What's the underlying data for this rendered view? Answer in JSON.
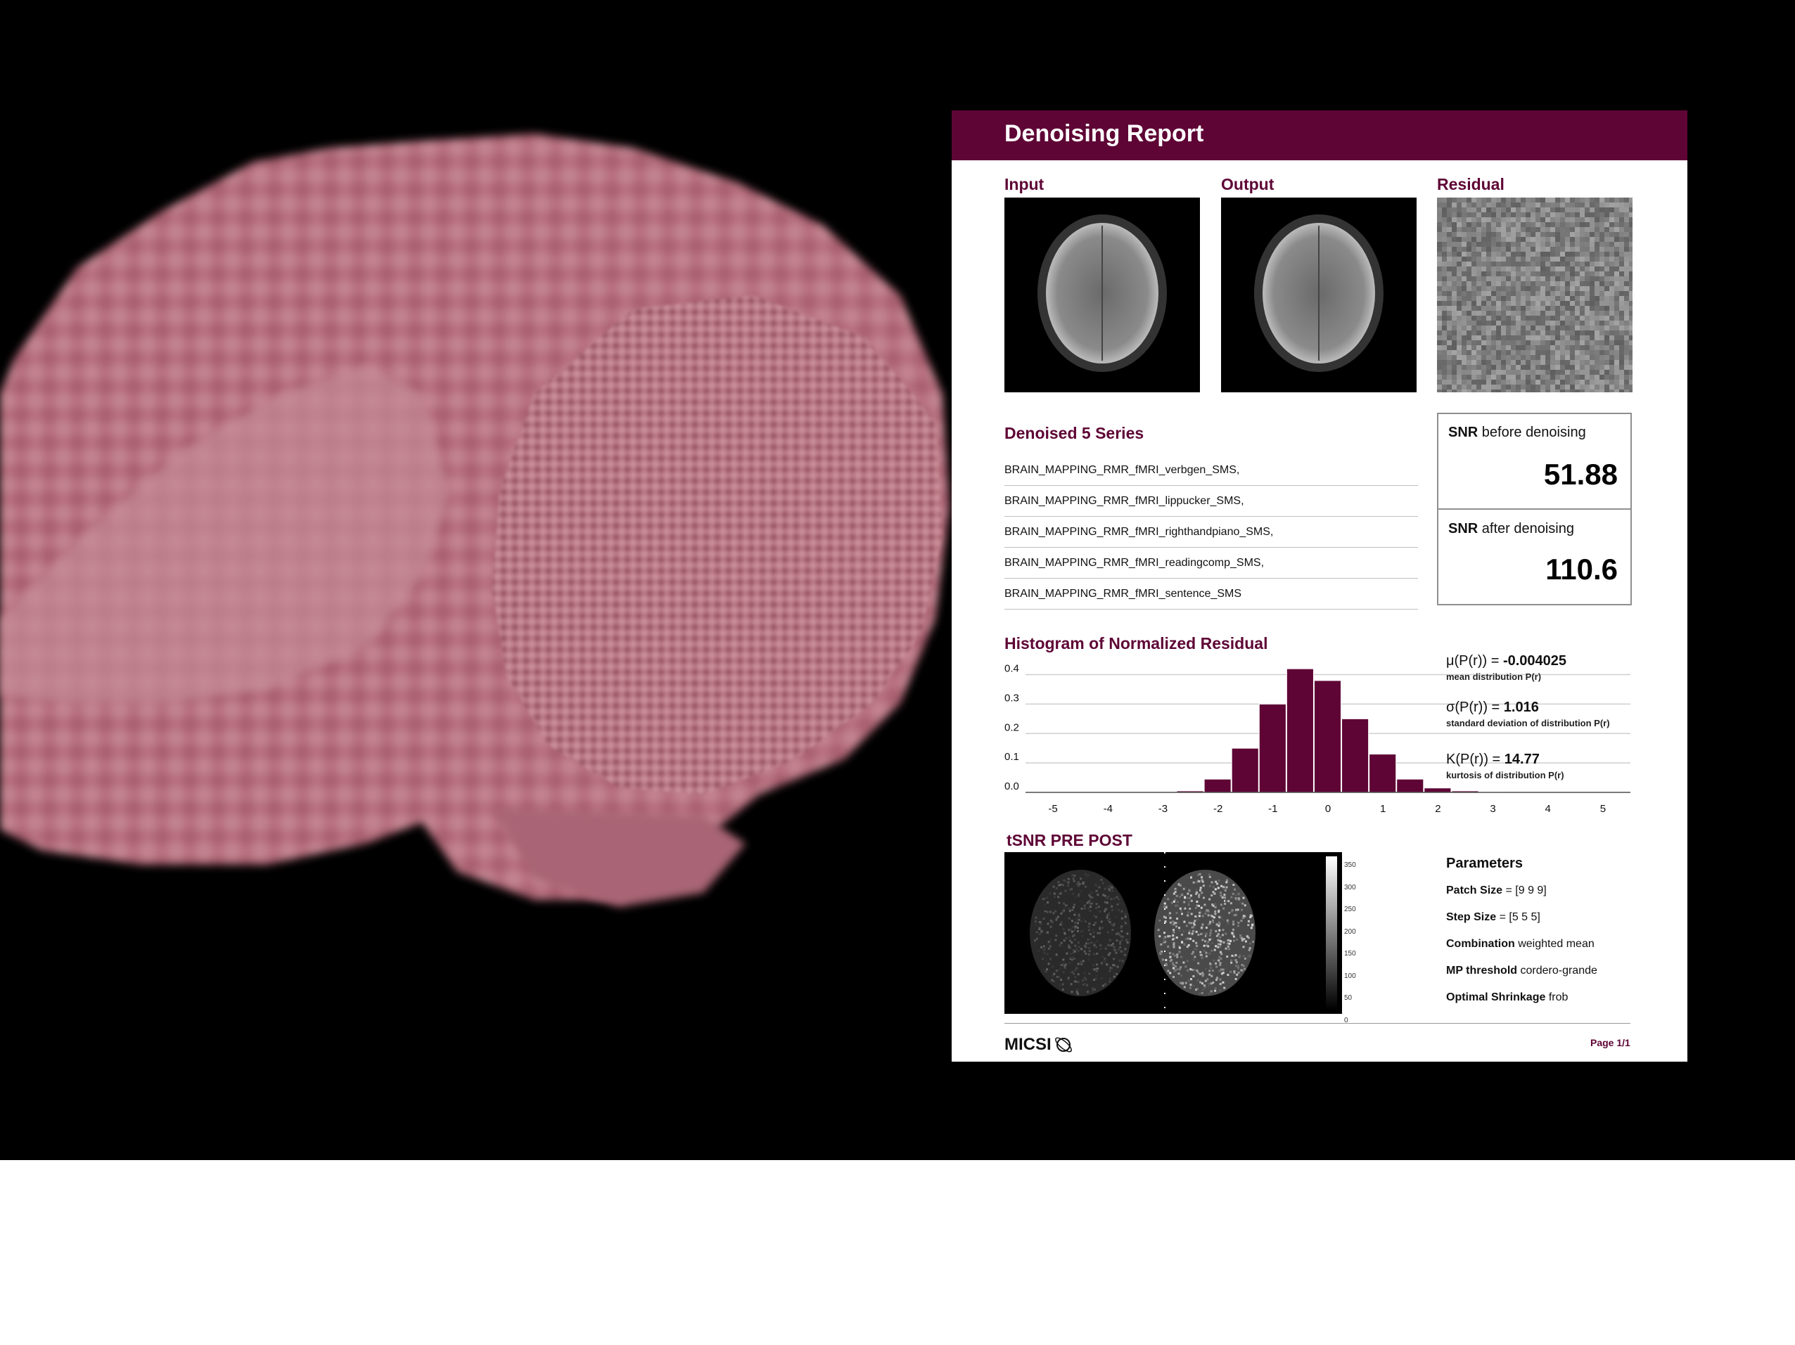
{
  "report": {
    "title": "Denoising Report",
    "images": {
      "input": "Input",
      "output": "Output",
      "residual": "Residual"
    },
    "series": {
      "heading": "Denoised 5 Series",
      "items": [
        "BRAIN_MAPPING_RMR_fMRI_verbgen_SMS,",
        "BRAIN_MAPPING_RMR_fMRI_lippucker_SMS,",
        "BRAIN_MAPPING_RMR_fMRI_righthandpiano_SMS,",
        "BRAIN_MAPPING_RMR_fMRI_readingcomp_SMS,",
        "BRAIN_MAPPING_RMR_fMRI_sentence_SMS"
      ]
    },
    "snr": {
      "before_prefix": "SNR",
      "before_suffix": "before denoising",
      "before_value": "51.88",
      "after_prefix": "SNR",
      "after_suffix": "after denoising",
      "after_value": "110.6"
    },
    "histogram": {
      "heading": "Histogram of Normalized Residual"
    },
    "stats": {
      "mean_label": "μ(P(r)) =",
      "mean_value": "-0.004025",
      "mean_desc": "mean distribution P(r)",
      "std_label": "σ(P(r)) =",
      "std_value": "1.016",
      "std_desc": "standard deviation of distribution P(r)",
      "kurt_label": "K(P(r)) =",
      "kurt_value": "14.77",
      "kurt_desc": "kurtosis of distribution P(r)"
    },
    "tsnr": {
      "heading": "tSNR PRE POST",
      "colorbar_ticks": [
        "350",
        "300",
        "250",
        "200",
        "150",
        "100",
        "50",
        "0"
      ]
    },
    "parameters": {
      "heading": "Parameters",
      "patch_label": "Patch Size",
      "patch_value": "= [9 9 9]",
      "step_label": "Step Size",
      "step_value": "= [5 5 5]",
      "combo_label": "Combination",
      "combo_value": "weighted mean",
      "mp_label": "MP threshold",
      "mp_value": "cordero-grande",
      "shrink_label": "Optimal Shrinkage",
      "shrink_value": "frob"
    },
    "footer": {
      "logo": "MICSI",
      "page": "Page 1/1"
    },
    "colors": {
      "brand": "#5e0535",
      "brain": "#b97a85"
    }
  },
  "chart_data": {
    "type": "bar",
    "x": [
      -2.5,
      -2,
      -1.5,
      -1,
      -0.5,
      0,
      0.5,
      1,
      1.5,
      2,
      2.5,
      3
    ],
    "values": [
      0.005,
      0.045,
      0.15,
      0.3,
      0.42,
      0.38,
      0.25,
      0.13,
      0.045,
      0.015,
      0.005,
      0.002
    ],
    "xticks": [
      -5,
      -4,
      -3,
      -2,
      -1,
      0,
      1,
      2,
      3,
      4,
      5
    ],
    "yticks": [
      0.0,
      0.1,
      0.2,
      0.3,
      0.4
    ],
    "ylim": [
      0,
      0.43
    ],
    "xlim": [
      -5.5,
      5.5
    ],
    "grid": true,
    "title": "Histogram of Normalized Residual",
    "xlabel": "",
    "ylabel": ""
  }
}
